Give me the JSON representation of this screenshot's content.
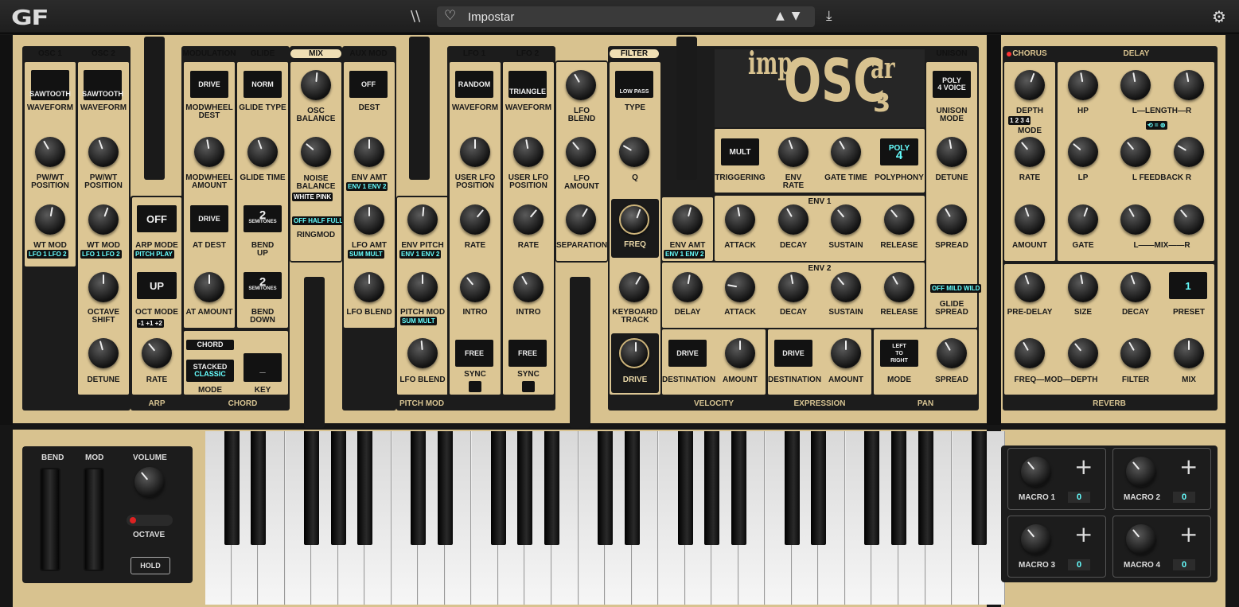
{
  "app": {
    "logo": "GF",
    "preset_name": "Impostar",
    "arrows": "▲▼",
    "lib_icon": "\\\\",
    "heart": "♡",
    "download": "⤓",
    "gear": "⚙"
  },
  "osc1": {
    "title": "OSC 1",
    "waveform": "SAWTOOTH",
    "waveform_label": "WAVEFORM",
    "pw_label": "PW/WT\nPOSITION",
    "wtmod_label": "WT MOD",
    "tags": "LFO 1  LFO 2"
  },
  "osc2": {
    "title": "OSC 2",
    "waveform": "SAWTOOTH",
    "waveform_label": "WAVEFORM",
    "pw_label": "PW/WT\nPOSITION",
    "wtmod_label": "WT MOD",
    "tags": "LFO 1  LFO 2",
    "octave_label": "OCTAVE\nSHIFT",
    "detune_label": "DETUNE"
  },
  "arp": {
    "mode_value": "OFF",
    "mode_label": "ARP MODE",
    "mode_tags": "PITCH  PLAY",
    "oct_value": "UP",
    "oct_label": "OCT MODE",
    "oct_tags": "-1  +1  +2",
    "rate_label": "RATE",
    "footer": "ARP"
  },
  "modulation": {
    "title": "MODULATION",
    "dest_value": "DRIVE",
    "dest_label": "MODWHEEL\nDEST",
    "amount_label": "MODWHEEL\nAMOUNT",
    "at_dest_value": "DRIVE",
    "at_dest_label": "AT DEST",
    "at_amount_label": "AT AMOUNT"
  },
  "glide": {
    "title": "GLIDE",
    "type_value": "NORM",
    "type_label": "GLIDE TYPE",
    "time_label": "GLIDE TIME",
    "bend_up_value": "2",
    "bend_up_unit": "SEMITONES",
    "bend_up_label": "BEND\nUP",
    "bend_down_value": "2",
    "bend_down_unit": "SEMITONES",
    "bend_down_label": "BEND\nDOWN"
  },
  "chord": {
    "title": "CHORD",
    "mode_value": "STACKED",
    "mode_value2": "CLASSIC",
    "mode_label": "MODE",
    "key_value": "_",
    "key_label": "KEY",
    "footer": "CHORD"
  },
  "mix": {
    "title": "MIX",
    "osc_balance": "OSC\nBALANCE",
    "noise_balance": "NOISE\nBALANCE",
    "noise_tags": "WHITE  PINK",
    "ringmod_tags": "OFF  HALF  FULL",
    "ringmod_label": "RINGMOD"
  },
  "auxmod": {
    "title": "AUX MOD",
    "dest_value": "OFF",
    "dest_label": "DEST",
    "env_amt": "ENV AMT",
    "env_tags": "ENV 1  ENV 2",
    "lfo_amt": "LFO AMT",
    "lfo_tags": "SUM  MULT",
    "lfo_blend": "LFO BLEND"
  },
  "pitchmod": {
    "env_pitch": "ENV PITCH",
    "env_tags": "ENV 1  ENV 2",
    "pitch_mod": "PITCH MOD",
    "pm_tags": "SUM  MULT",
    "lfo_blend": "LFO BLEND",
    "footer": "PITCH MOD"
  },
  "lfo1": {
    "title": "LFO 1",
    "waveform": "RANDOM",
    "waveform_label": "WAVEFORM",
    "user_pos": "USER LFO\nPOSITION",
    "rate": "RATE",
    "intro": "INTRO",
    "sync_value": "FREE",
    "sync_label": "SYNC"
  },
  "lfo2": {
    "title": "LFO 2",
    "waveform": "TRIANGLE",
    "waveform_label": "WAVEFORM",
    "user_pos": "USER LFO\nPOSITION",
    "rate": "RATE",
    "intro": "INTRO",
    "sync_value": "FREE",
    "sync_label": "SYNC"
  },
  "lfomix": {
    "blend": "LFO\nBLEND",
    "amount": "LFO\nAMOUNT",
    "separation": "SEPARATION"
  },
  "filter": {
    "title": "FILTER",
    "type_value": "LOW PASS",
    "type_label": "TYPE",
    "q_label": "Q",
    "freq_label": "FREQ",
    "kbd_label": "KEYBOARD\nTRACK",
    "drive_label": "DRIVE",
    "env_amt": "ENV AMT",
    "env_tags": "ENV 1  ENV 2"
  },
  "brand": {
    "pre": "imp",
    "main": "OSC",
    "post": "ar",
    "num": "3"
  },
  "voice": {
    "trig_value": "MULT",
    "trig_label": "TRIGGERING",
    "env_rate": "ENV\nRATE",
    "gate_time": "GATE TIME",
    "poly_value": "POLY",
    "poly_num": "4",
    "poly_label": "POLYPHONY"
  },
  "env1": {
    "title": "ENV 1",
    "attack": "ATTACK",
    "decay": "DECAY",
    "sustain": "SUSTAIN",
    "release": "RELEASE"
  },
  "env2": {
    "title": "ENV 2",
    "delay": "DELAY",
    "attack": "ATTACK",
    "decay": "DECAY",
    "sustain": "SUSTAIN",
    "release": "RELEASE"
  },
  "unison": {
    "title": "UNISON",
    "mode_value": "POLY\n4 VOICE",
    "mode_label": "UNISON\nMODE",
    "detune": "DETUNE",
    "spread": "SPREAD",
    "glide_tags": "OFF  MILD  WILD",
    "glide_label": "GLIDE\nSPREAD"
  },
  "velocity": {
    "dest_value": "DRIVE",
    "dest_label": "DESTINATION",
    "amount": "AMOUNT",
    "footer": "VELOCITY"
  },
  "expression": {
    "dest_value": "DRIVE",
    "dest_label": "DESTINATION",
    "amount": "AMOUNT",
    "footer": "EXPRESSION"
  },
  "pan": {
    "mode_value": "LEFT\nTO\nRIGHT",
    "mode_label": "MODE",
    "spread": "SPREAD",
    "footer": "PAN"
  },
  "chorus": {
    "title": "CHORUS",
    "depth": "DEPTH",
    "modes": "1  2  3  4",
    "mode_label": "MODE",
    "rate": "RATE",
    "amount": "AMOUNT"
  },
  "delay": {
    "title": "DELAY",
    "hp": "HP",
    "length": "L—LENGTH—R",
    "link": "⟲ = ⊚",
    "lp": "LP",
    "feedback": "L FEEDBACK R",
    "gate": "GATE",
    "mix": "L——MIX——R"
  },
  "reverb": {
    "predelay": "PRE-DELAY",
    "size": "SIZE",
    "decay": "DECAY",
    "preset_value": "1",
    "preset_label": "PRESET",
    "freq": "FREQ—MOD—DEPTH",
    "filter": "FILTER",
    "mix": "MIX",
    "footer": "REVERB"
  },
  "perf": {
    "bend": "BEND",
    "mod": "MOD",
    "volume": "VOLUME",
    "octave": "OCTAVE",
    "hold": "HOLD"
  },
  "macros": [
    {
      "label": "MACRO 1",
      "value": "0"
    },
    {
      "label": "MACRO 2",
      "value": "0"
    },
    {
      "label": "MACRO 3",
      "value": "0"
    },
    {
      "label": "MACRO 4",
      "value": "0"
    }
  ]
}
